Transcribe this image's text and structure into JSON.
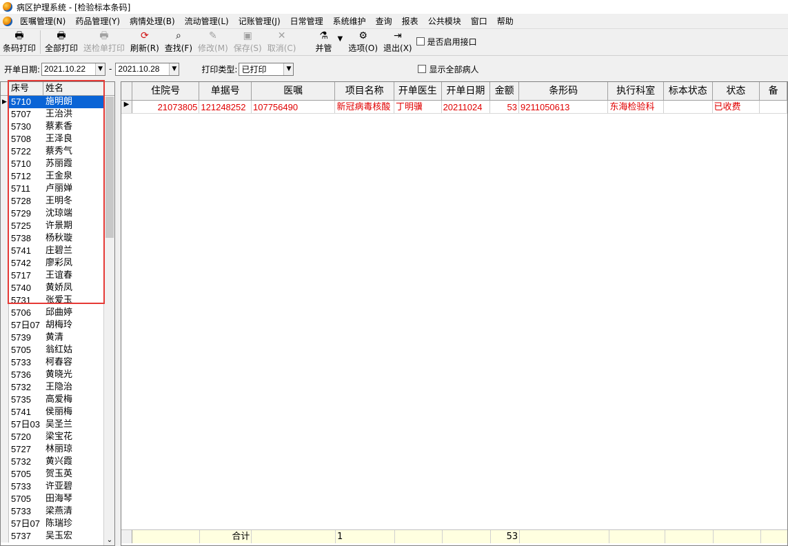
{
  "window": {
    "title": "病区护理系统 - [检验标本条码]"
  },
  "menu": [
    "医嘱管理(N)",
    "药品管理(Y)",
    "病情处理(B)",
    "流动管理(L)",
    "记账管理(J)",
    "日常管理",
    "系统维护",
    "查询",
    "报表",
    "公共模块",
    "窗口",
    "帮助"
  ],
  "toolbar": {
    "barcode_print": "条码打印",
    "print_all": "全部打印",
    "send_print": "送检单打印",
    "refresh": "刷新(R)",
    "find": "查找(F)",
    "modify": "修改(M)",
    "save": "保存(S)",
    "cancel": "取消(C)",
    "merge": "并管",
    "options": "选项(O)",
    "exit": "退出(X)",
    "enable_interface": "是否启用接口"
  },
  "filter": {
    "date_label": "开单日期:",
    "date_from": "2021.10.22",
    "dash": "-",
    "date_to": "2021.10.28",
    "print_type_label": "打印类型:",
    "print_type_value": "已打印",
    "show_all_label": "显示全部病人"
  },
  "patients": {
    "headers": {
      "bed": "床号",
      "name": "姓名"
    },
    "rows": [
      {
        "bed": "5710",
        "name": "施明朗"
      },
      {
        "bed": "5707",
        "name": "王治洪"
      },
      {
        "bed": "5730",
        "name": "蔡素香"
      },
      {
        "bed": "5708",
        "name": "王泽良"
      },
      {
        "bed": "5722",
        "name": "蔡秀气"
      },
      {
        "bed": "5710",
        "name": "苏丽霞"
      },
      {
        "bed": "5712",
        "name": "王金泉"
      },
      {
        "bed": "5711",
        "name": "卢丽婵"
      },
      {
        "bed": "5728",
        "name": "王明冬"
      },
      {
        "bed": "5729",
        "name": "沈琼端"
      },
      {
        "bed": "5725",
        "name": "许景期"
      },
      {
        "bed": "5738",
        "name": "杨秋璇"
      },
      {
        "bed": "5741",
        "name": "庄碧兰"
      },
      {
        "bed": "5742",
        "name": "廖彩凤"
      },
      {
        "bed": "5717",
        "name": "王谊春"
      },
      {
        "bed": "5740",
        "name": "黄娇凤"
      },
      {
        "bed": "5731",
        "name": "张爱玉"
      },
      {
        "bed": "5706",
        "name": "邱曲婷"
      },
      {
        "bed": "57日07",
        "name": "胡梅玲"
      },
      {
        "bed": "5739",
        "name": "黄清"
      },
      {
        "bed": "5705",
        "name": "翁红姑"
      },
      {
        "bed": "5733",
        "name": "柯春容"
      },
      {
        "bed": "5736",
        "name": "黄晓光"
      },
      {
        "bed": "5732",
        "name": "王隐治"
      },
      {
        "bed": "5735",
        "name": "高爱梅"
      },
      {
        "bed": "5741",
        "name": "侯丽梅"
      },
      {
        "bed": "57日03",
        "name": "吴圣兰"
      },
      {
        "bed": "5720",
        "name": "梁宝花"
      },
      {
        "bed": "5727",
        "name": "林丽琼"
      },
      {
        "bed": "5732",
        "name": "黄兴霞"
      },
      {
        "bed": "5705",
        "name": "贺玉英"
      },
      {
        "bed": "5733",
        "name": "许亚碧"
      },
      {
        "bed": "5705",
        "name": "田海琴"
      },
      {
        "bed": "5733",
        "name": "梁燕清"
      },
      {
        "bed": "57日07",
        "name": "陈瑞珍"
      },
      {
        "bed": "5737",
        "name": "吴玉宏"
      }
    ]
  },
  "orders": {
    "headers": [
      "住院号",
      "单据号",
      "医嘱",
      "项目名称",
      "开单医生",
      "开单日期",
      "金额",
      "条形码",
      "执行科室",
      "标本状态",
      "状态",
      "备"
    ],
    "rows": [
      [
        "21073805",
        "121248252",
        "107756490",
        "新冠病毒核酸",
        "丁明骥",
        "20211024",
        "53",
        "9211050613",
        "东海检验科",
        "",
        "已收费",
        ""
      ]
    ],
    "footer": {
      "total_label": "合计",
      "count": "1",
      "amount": "53"
    }
  },
  "colors": {
    "selected_row": "#0a64d6",
    "order_text": "#e00000",
    "highlight_box": "#e53935",
    "footer_bg": "#ffffe0"
  }
}
